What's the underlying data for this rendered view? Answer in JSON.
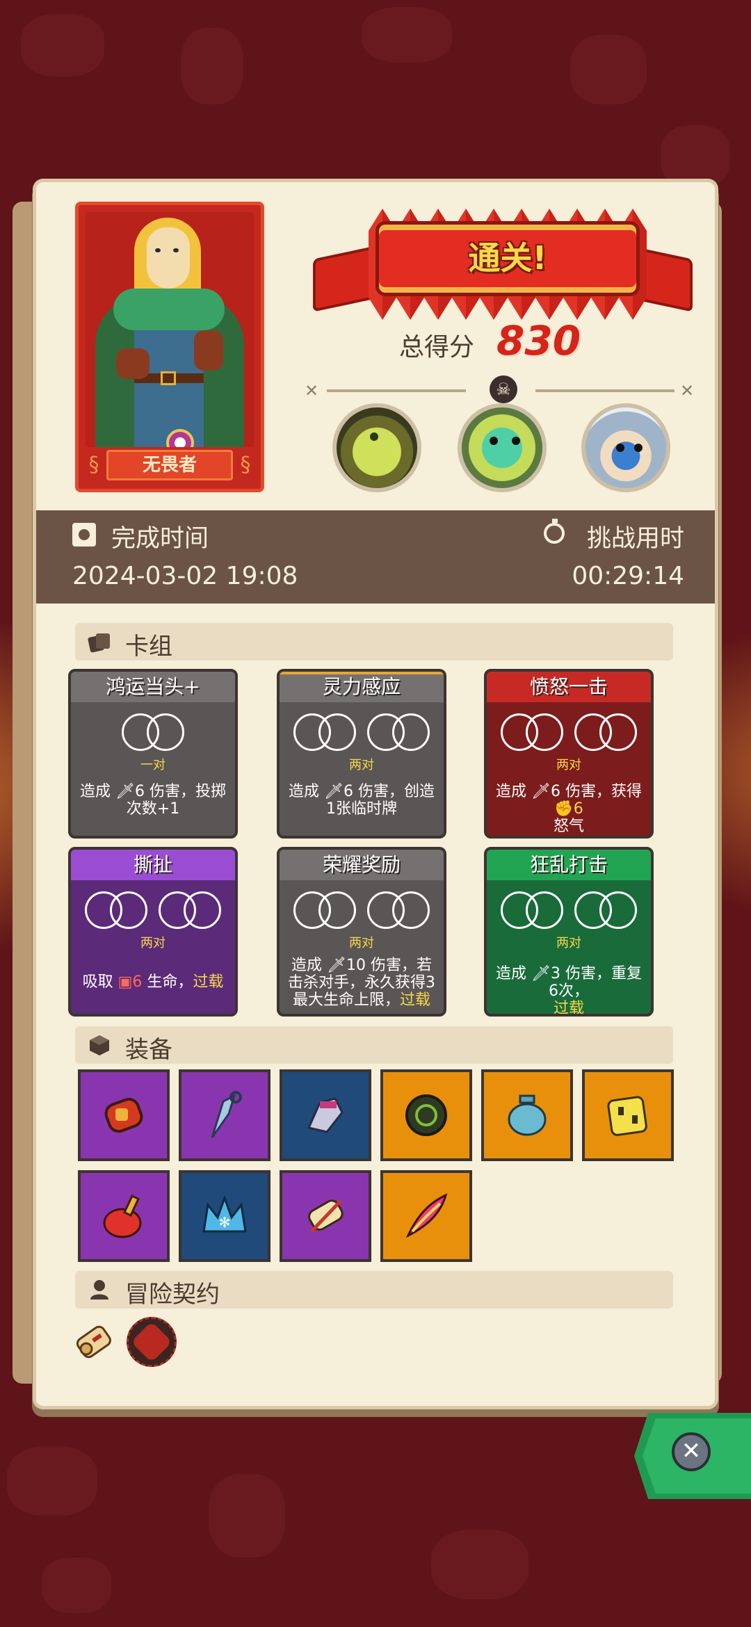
{
  "hero": {
    "name": "无畏者"
  },
  "banner": {
    "title": "通关!"
  },
  "score": {
    "label": "总得分",
    "value": "830"
  },
  "bosses": [
    "skeleton-dragon",
    "green-dragon",
    "yeti"
  ],
  "times": {
    "finish_label": "完成时间",
    "finish_value": "2024-03-02 19:08",
    "duration_label": "挑战用时",
    "duration_value": "00:29:14"
  },
  "sections": {
    "deck": "卡组",
    "equipment": "装备",
    "contract": "冒险契约"
  },
  "cards": [
    {
      "name": "鸿运当头+",
      "combo": "一对",
      "desc": "造成 🗡6 伤害，投掷次数+1",
      "rings": 1,
      "color": "gray"
    },
    {
      "name": "灵力感应",
      "combo": "两对",
      "desc": "造成 🗡6 伤害，创造1张临时牌",
      "rings": 2,
      "color": "gray"
    },
    {
      "name": "愤怒一击",
      "combo": "两对",
      "desc": "造成 🗡6 伤害，获得",
      "desc_extra": "6",
      "desc_tail": "怒气",
      "rings": 2,
      "color": "red"
    },
    {
      "name": "撕扯",
      "combo": "两对",
      "desc": "吸取",
      "desc_extra": "6",
      "desc_tail": "生命，",
      "desc_keyword": "过载",
      "rings": 2,
      "color": "purple"
    },
    {
      "name": "荣耀奖励",
      "combo": "两对",
      "desc": "造成 🗡10 伤害，若击杀对手，永久获得3最大生命上限，",
      "desc_keyword": "过载",
      "rings": 2,
      "color": "gray"
    },
    {
      "name": "狂乱打击",
      "combo": "两对",
      "desc": "造成 🗡3 伤害，重复6次，",
      "desc_keyword": "过载",
      "rings": 2,
      "color": "green"
    }
  ],
  "equipment": [
    {
      "icon": "red-gauntlet",
      "rarity": "purple"
    },
    {
      "icon": "ice-dagger",
      "rarity": "purple"
    },
    {
      "icon": "armored-glove",
      "rarity": "blue"
    },
    {
      "icon": "dark-horn",
      "rarity": "orange"
    },
    {
      "icon": "blue-vase",
      "rarity": "orange"
    },
    {
      "icon": "yellow-die",
      "rarity": "orange"
    },
    {
      "icon": "red-potion",
      "rarity": "purple"
    },
    {
      "icon": "ice-crown",
      "rarity": "blue"
    },
    {
      "icon": "scroll-blade",
      "rarity": "purple"
    },
    {
      "icon": "flame-feather",
      "rarity": "orange"
    }
  ],
  "contract": [
    "scroll-icon",
    "red-rune-icon"
  ],
  "colors": {
    "accent_red": "#d62418",
    "highlight": "#f6d84a",
    "panel": "#f6efd9",
    "band": "#6b5346"
  }
}
